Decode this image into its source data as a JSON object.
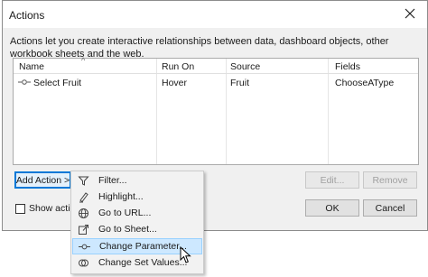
{
  "dialog": {
    "title": "Actions",
    "description": "Actions let you create interactive relationships between data, dashboard objects, other workbook sheets and the web."
  },
  "table": {
    "headers": {
      "name": "Name",
      "run_on": "Run On",
      "source": "Source",
      "fields": "Fields"
    },
    "rows": [
      {
        "name": "Select Fruit",
        "run_on": "Hover",
        "source": "Fruit",
        "fields": "ChooseAType"
      }
    ]
  },
  "buttons": {
    "add_action": "Add Action >",
    "edit": "Edit...",
    "remove": "Remove",
    "ok": "OK",
    "cancel": "Cancel"
  },
  "show_actions_label": "Show actions",
  "menu": {
    "items": [
      {
        "label": "Filter...",
        "icon": "filter-icon"
      },
      {
        "label": "Highlight...",
        "icon": "highlight-icon"
      },
      {
        "label": "Go to URL...",
        "icon": "globe-icon"
      },
      {
        "label": "Go to Sheet...",
        "icon": "go-to-sheet-icon"
      },
      {
        "label": "Change Parameter...",
        "icon": "parameter-icon"
      },
      {
        "label": "Change Set Values...",
        "icon": "set-icon"
      }
    ]
  }
}
